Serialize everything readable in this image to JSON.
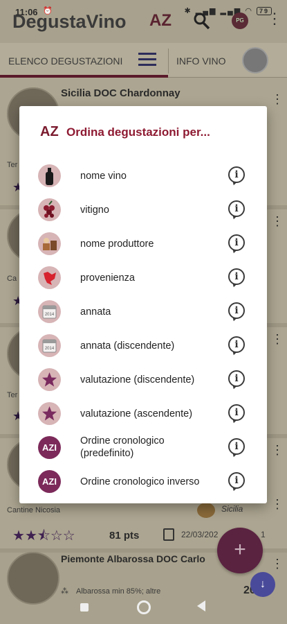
{
  "status": {
    "time": "11:06",
    "battery": "79"
  },
  "app": {
    "title": "DegustaVino",
    "logo": "AZ"
  },
  "tabs": [
    {
      "label": "ELENCO DEGUSTAZIONI"
    },
    {
      "label": "INFO VINO"
    }
  ],
  "background": {
    "card1_title": "Sicilia DOC Chardonnay",
    "edge_labels": [
      "Ter",
      "Ca",
      "Ter"
    ],
    "producer": "Cantine Nicosia",
    "region": "Sicilia",
    "points": "81 pts",
    "date": "22/03/202",
    "date_suffix": "1",
    "card2_title": "Piemonte Albarossa DOC Carlo",
    "grape": "Albarossa min 85%; altre",
    "year": "2017"
  },
  "dialog": {
    "logo": "AZ",
    "title": "Ordina degustazioni per...",
    "options": [
      {
        "label": "nome vino",
        "icon": "wine-bottle-icon"
      },
      {
        "label": "vitigno",
        "icon": "grape-icon"
      },
      {
        "label": "nome produttore",
        "icon": "producer-icon"
      },
      {
        "label": "provenienza",
        "icon": "map-icon"
      },
      {
        "label": "annata",
        "icon": "calendar-icon"
      },
      {
        "label": "annata (discendente)",
        "icon": "calendar-icon"
      },
      {
        "label": "valutazione (discendente)",
        "icon": "star-icon"
      },
      {
        "label": "valutazione (ascendente)",
        "icon": "star-icon"
      },
      {
        "label": "Ordine cronologico\n(predefinito)",
        "icon": "azi-icon"
      },
      {
        "label": "Ordine cronologico inverso",
        "icon": "azi-icon"
      }
    ],
    "azi_text": "AZI",
    "calendar_year": "2014"
  },
  "colors": {
    "accent": "#8e1a32",
    "icon_bg": "#d7b4b6",
    "icon_dark": "#7c2a5a",
    "fab": "#5a2340"
  }
}
